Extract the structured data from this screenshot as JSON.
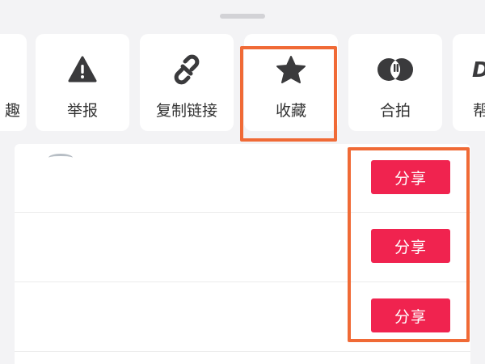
{
  "share_panel": {
    "actions": [
      {
        "id": "partial-left",
        "label": "趣",
        "icon": "partial"
      },
      {
        "id": "report",
        "label": "举报",
        "icon": "warning-icon"
      },
      {
        "id": "copy-link",
        "label": "复制链接",
        "icon": "link-icon"
      },
      {
        "id": "favorite",
        "label": "收藏",
        "icon": "star-icon"
      },
      {
        "id": "duet",
        "label": "合拍",
        "icon": "duet-icon"
      },
      {
        "id": "partial-right",
        "label": "帮",
        "icon": "partial"
      }
    ],
    "right_partial_glyph": "D"
  },
  "share_list": {
    "rows": [
      {
        "button_label": "分享"
      },
      {
        "button_label": "分享"
      },
      {
        "button_label": "分享"
      }
    ]
  },
  "colors": {
    "share_button": "#f0234f",
    "highlight_border": "#f06a36",
    "icon": "#3a3a3c",
    "panel_bg": "#f3f3f5"
  }
}
